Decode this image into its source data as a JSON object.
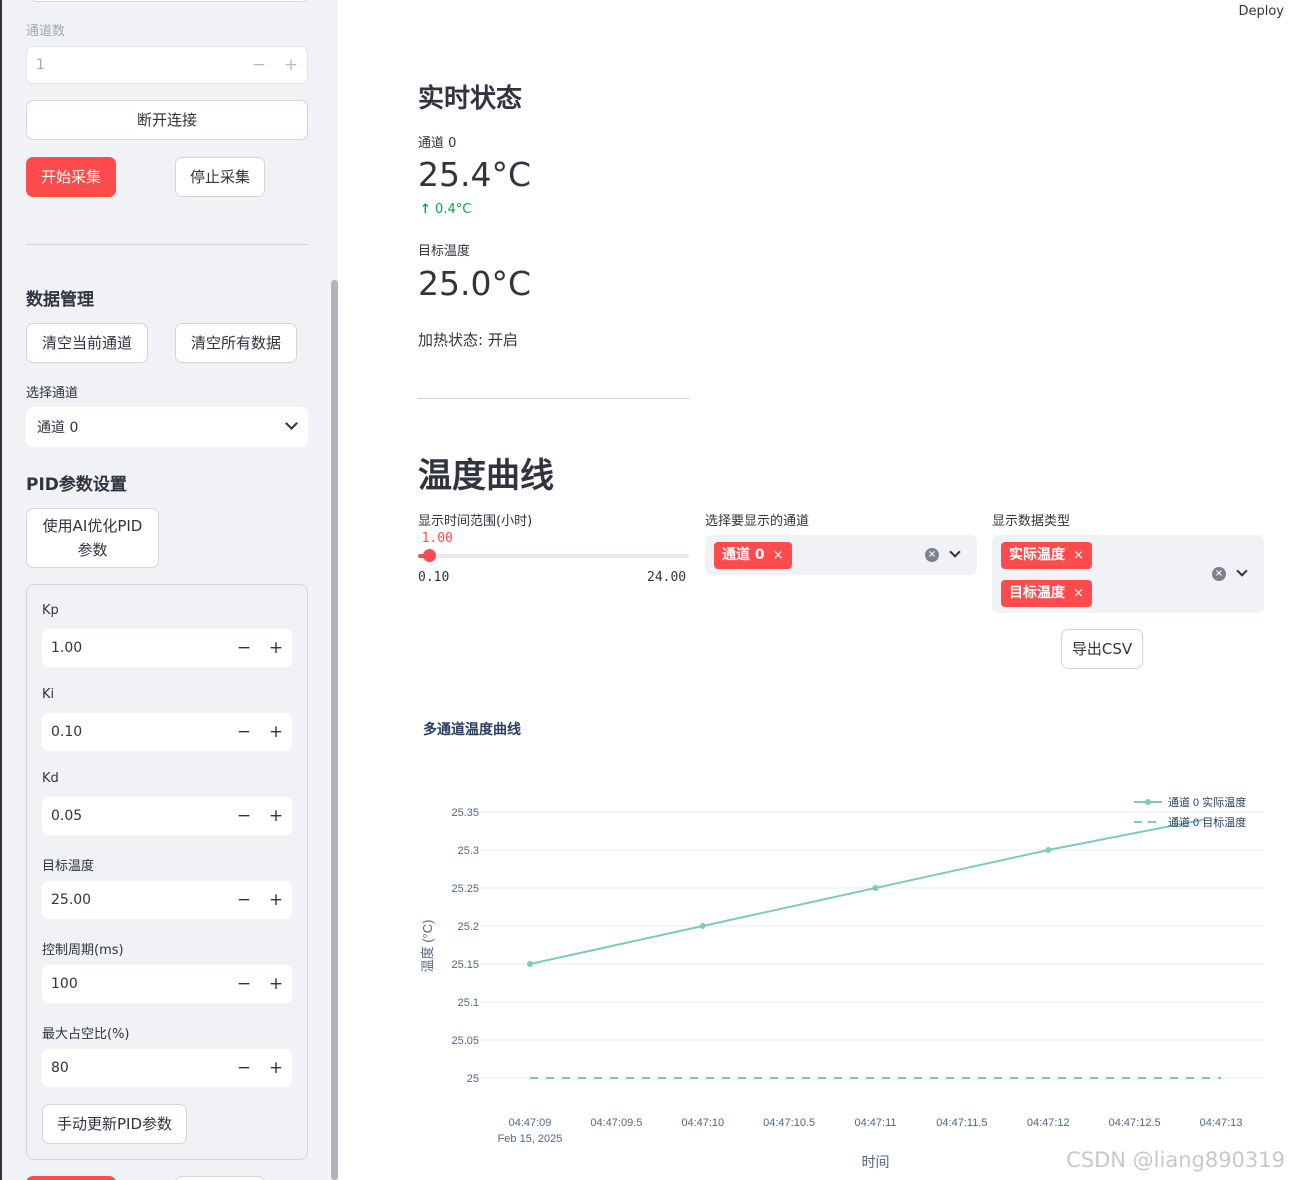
{
  "sidebar": {
    "channels_label": "通道数",
    "channels_value": "1",
    "disconnect_label": "断开连接",
    "start_label": "开始采集",
    "stop_label": "停止采集",
    "data_mgmt_title": "数据管理",
    "clear_current_label": "清空当前通道",
    "clear_all_label": "清空所有数据",
    "select_channel_label": "选择通道",
    "select_channel_value": "通道 0",
    "pid_title": "PID参数设置",
    "ai_optimize_label": "使用AI优化PID参数",
    "fields": [
      {
        "label": "Kp",
        "value": "1.00"
      },
      {
        "label": "Ki",
        "value": "0.10"
      },
      {
        "label": "Kd",
        "value": "0.05"
      },
      {
        "label": "目标温度",
        "value": "25.00"
      },
      {
        "label": "控制周期(ms)",
        "value": "100"
      },
      {
        "label": "最大占空比(%)",
        "value": "80"
      }
    ],
    "manual_update_label": "手动更新PID参数",
    "minus": "−",
    "plus": "+"
  },
  "header": {
    "deploy_label": "Deploy"
  },
  "status": {
    "title": "实时状态",
    "channel_label": "通道 0",
    "channel_value": "25.4°C",
    "channel_delta": "0.4°C",
    "target_label": "目标温度",
    "target_value": "25.0°C",
    "heating_text": "加热状态: 开启"
  },
  "curve": {
    "title": "温度曲线",
    "time_range_label": "显示时间范围(小时)",
    "time_range_value": "1.00",
    "time_range_fraction": 0.039,
    "time_range_min": "0.10",
    "time_range_max": "24.00",
    "channels_label": "选择要显示的通道",
    "channel_tag": "通道 0",
    "types_label": "显示数据类型",
    "type_tags": [
      "实际温度",
      "目标温度"
    ],
    "export_label": "导出CSV",
    "tag_close": "×"
  },
  "chart_data": {
    "type": "line",
    "title": "多通道温度曲线",
    "xlabel": "时间",
    "ylabel": "温度 (°C)",
    "x_ticks": [
      "04:47:09",
      "04:47:09.5",
      "04:47:10",
      "04:47:10.5",
      "04:47:11",
      "04:47:11.5",
      "04:47:12",
      "04:47:12.5",
      "04:47:13"
    ],
    "x_tick_sub": "Feb 15, 2025",
    "xlim": [
      "04:47:09",
      "04:47:13"
    ],
    "y_ticks": [
      "25",
      "25.05",
      "25.1",
      "25.15",
      "25.2",
      "25.25",
      "25.3",
      "25.35"
    ],
    "ylim": [
      25,
      25.35
    ],
    "grid": true,
    "legend_position": "top-right",
    "series": [
      {
        "name": "通道 0 实际温度",
        "style": "lines+markers",
        "color": "#7dcbb8",
        "x": [
          "04:47:09",
          "04:47:10",
          "04:47:11",
          "04:47:12",
          "04:47:12.9"
        ],
        "y": [
          25.15,
          25.2,
          25.25,
          25.3,
          25.34
        ]
      },
      {
        "name": "通道 0 目标温度",
        "style": "dash",
        "color": "#7dcbb8",
        "x": [
          "04:47:09",
          "04:47:13"
        ],
        "y": [
          25,
          25
        ]
      }
    ]
  },
  "watermark": "CSDN @liang890319"
}
